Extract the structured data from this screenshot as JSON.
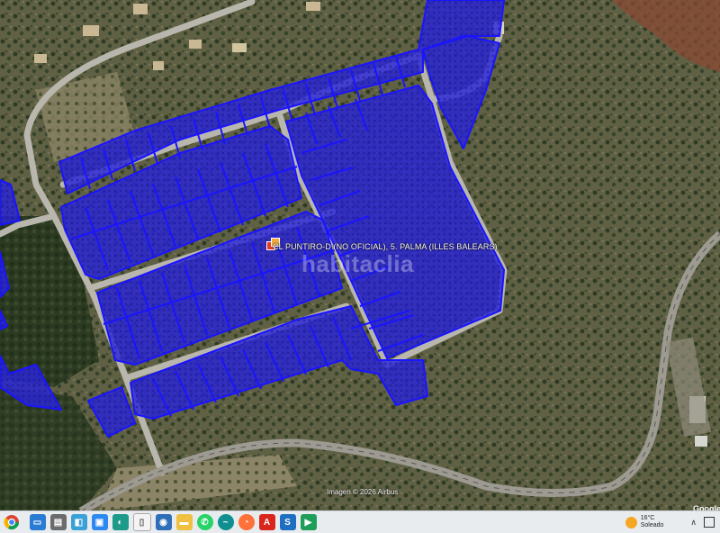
{
  "map": {
    "address_label": "CL PUNTIRO-D (NO OFICIAL), 5. PALMA (ILLES BALEARS)",
    "watermark": "habitaclia",
    "imagery_credit": "Imagen © 2026 Airbus",
    "provider": "Google",
    "colors": {
      "parcel_fill": "#2a24d8",
      "parcel_stroke": "#1a14ff",
      "road": "#b9b7ad",
      "terrain": "#5f6044",
      "vegetation": "#2f3d24"
    }
  },
  "taskbar": {
    "icons": [
      "chrome-icon",
      "monitor-icon",
      "explorer-icon",
      "app-icon",
      "image-icon",
      "edge-icon",
      "file-icon",
      "explorer-alt-icon",
      "whatsapp-icon",
      "swoosh-icon",
      "firefox-icon",
      "acrobat-icon",
      "s-app-icon",
      "green-app-icon"
    ],
    "weather_temp": "16°C",
    "weather_desc": "Soleado"
  }
}
